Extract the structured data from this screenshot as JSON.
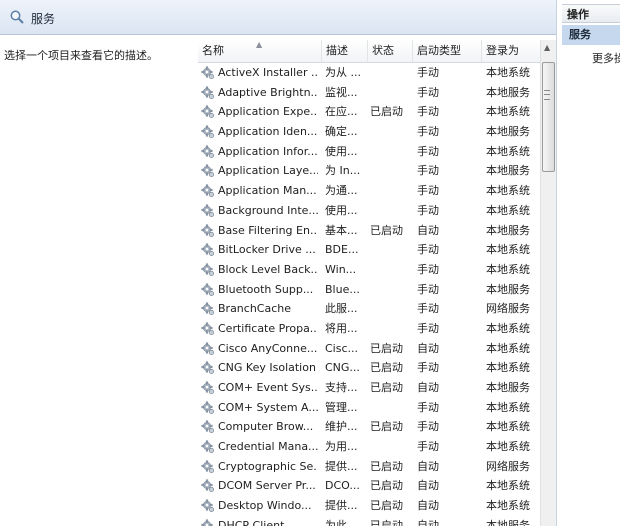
{
  "header": {
    "title": "服务"
  },
  "description_panel": {
    "text": "选择一个项目来查看它的描述。"
  },
  "columns": {
    "name": "名称",
    "desc": "描述",
    "status": "状态",
    "startup": "启动类型",
    "logon": "登录为"
  },
  "actions": {
    "header": "操作",
    "section": "服务",
    "more": "更多操"
  },
  "services": [
    {
      "name": "ActiveX Installer ...",
      "desc": "为从 ...",
      "status": "",
      "startup": "手动",
      "logon": "本地系统"
    },
    {
      "name": "Adaptive Brightn...",
      "desc": "监视...",
      "status": "",
      "startup": "手动",
      "logon": "本地服务"
    },
    {
      "name": "Application Expe...",
      "desc": "在应...",
      "status": "已启动",
      "startup": "手动",
      "logon": "本地系统"
    },
    {
      "name": "Application Iden...",
      "desc": "确定...",
      "status": "",
      "startup": "手动",
      "logon": "本地服务"
    },
    {
      "name": "Application Infor...",
      "desc": "使用...",
      "status": "",
      "startup": "手动",
      "logon": "本地系统"
    },
    {
      "name": "Application Laye...",
      "desc": "为 In...",
      "status": "",
      "startup": "手动",
      "logon": "本地服务"
    },
    {
      "name": "Application Man...",
      "desc": "为通...",
      "status": "",
      "startup": "手动",
      "logon": "本地系统"
    },
    {
      "name": "Background Inte...",
      "desc": "使用...",
      "status": "",
      "startup": "手动",
      "logon": "本地系统"
    },
    {
      "name": "Base Filtering En...",
      "desc": "基本...",
      "status": "已启动",
      "startup": "自动",
      "logon": "本地服务"
    },
    {
      "name": "BitLocker Drive ...",
      "desc": "BDE...",
      "status": "",
      "startup": "手动",
      "logon": "本地系统"
    },
    {
      "name": "Block Level Back...",
      "desc": "Win...",
      "status": "",
      "startup": "手动",
      "logon": "本地系统"
    },
    {
      "name": "Bluetooth Supp...",
      "desc": "Blue...",
      "status": "",
      "startup": "手动",
      "logon": "本地服务"
    },
    {
      "name": "BranchCache",
      "desc": "此服...",
      "status": "",
      "startup": "手动",
      "logon": "网络服务"
    },
    {
      "name": "Certificate Propa...",
      "desc": "将用...",
      "status": "",
      "startup": "手动",
      "logon": "本地系统"
    },
    {
      "name": "Cisco AnyConne...",
      "desc": "Cisc...",
      "status": "已启动",
      "startup": "自动",
      "logon": "本地系统"
    },
    {
      "name": "CNG Key Isolation",
      "desc": "CNG...",
      "status": "已启动",
      "startup": "手动",
      "logon": "本地系统"
    },
    {
      "name": "COM+ Event Sys...",
      "desc": "支持...",
      "status": "已启动",
      "startup": "自动",
      "logon": "本地服务"
    },
    {
      "name": "COM+ System A...",
      "desc": "管理...",
      "status": "",
      "startup": "手动",
      "logon": "本地系统"
    },
    {
      "name": "Computer Brow...",
      "desc": "维护...",
      "status": "已启动",
      "startup": "手动",
      "logon": "本地系统"
    },
    {
      "name": "Credential Mana...",
      "desc": "为用...",
      "status": "",
      "startup": "手动",
      "logon": "本地系统"
    },
    {
      "name": "Cryptographic Se...",
      "desc": "提供...",
      "status": "已启动",
      "startup": "自动",
      "logon": "网络服务"
    },
    {
      "name": "DCOM Server Pr...",
      "desc": "DCO...",
      "status": "已启动",
      "startup": "自动",
      "logon": "本地系统"
    },
    {
      "name": "Desktop Windo...",
      "desc": "提供...",
      "status": "已启动",
      "startup": "自动",
      "logon": "本地系统"
    },
    {
      "name": "DHCP Client",
      "desc": "为此...",
      "status": "已启动",
      "startup": "自动",
      "logon": "本地服务"
    }
  ]
}
